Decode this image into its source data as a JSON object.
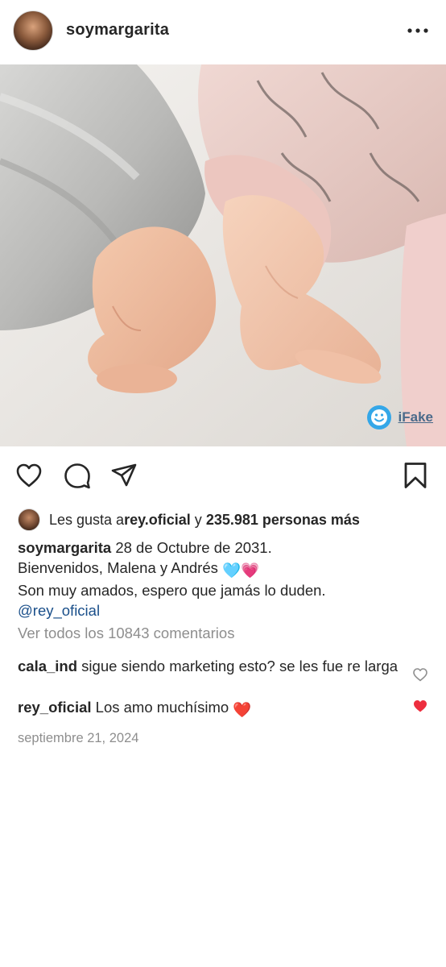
{
  "header": {
    "username": "soymargarita",
    "more_icon": "more-horizontal-icon"
  },
  "photo": {
    "watermark_text": "iFake",
    "watermark_icon": "smiley-face-icon"
  },
  "actions": {
    "like_icon": "heart-outline-icon",
    "comment_icon": "comment-bubble-icon",
    "share_icon": "paper-plane-icon",
    "save_icon": "bookmark-outline-icon"
  },
  "likes": {
    "prefix": "Les gusta a ",
    "user": "rey.oficial",
    "connector": " y ",
    "count_text": "235.981 personas más"
  },
  "caption": {
    "username": "soymargarita",
    "line1": " 28 de Octubre de 2031.",
    "line2": "Bienvenidos, Malena y Andrés ",
    "line2_emoji": "🩵💗",
    "line3": "Son muy amados, espero que jamás lo duden.",
    "mention": "@rey_oficial"
  },
  "view_all_comments": "Ver todos los 10843 comentarios",
  "comments": [
    {
      "username": "cala_ind",
      "text": " sigue siendo marketing esto? se les fue re larga",
      "liked": false
    },
    {
      "username": "rey_oficial",
      "text": " Los amo muchísimo ",
      "emoji": "❤️",
      "liked": true
    }
  ],
  "date": "septiembre 21, 2024",
  "colors": {
    "text": "#262626",
    "secondary": "#8e8e8e",
    "mention": "#1a4f8a",
    "liked_heart": "#ed2e3e"
  }
}
